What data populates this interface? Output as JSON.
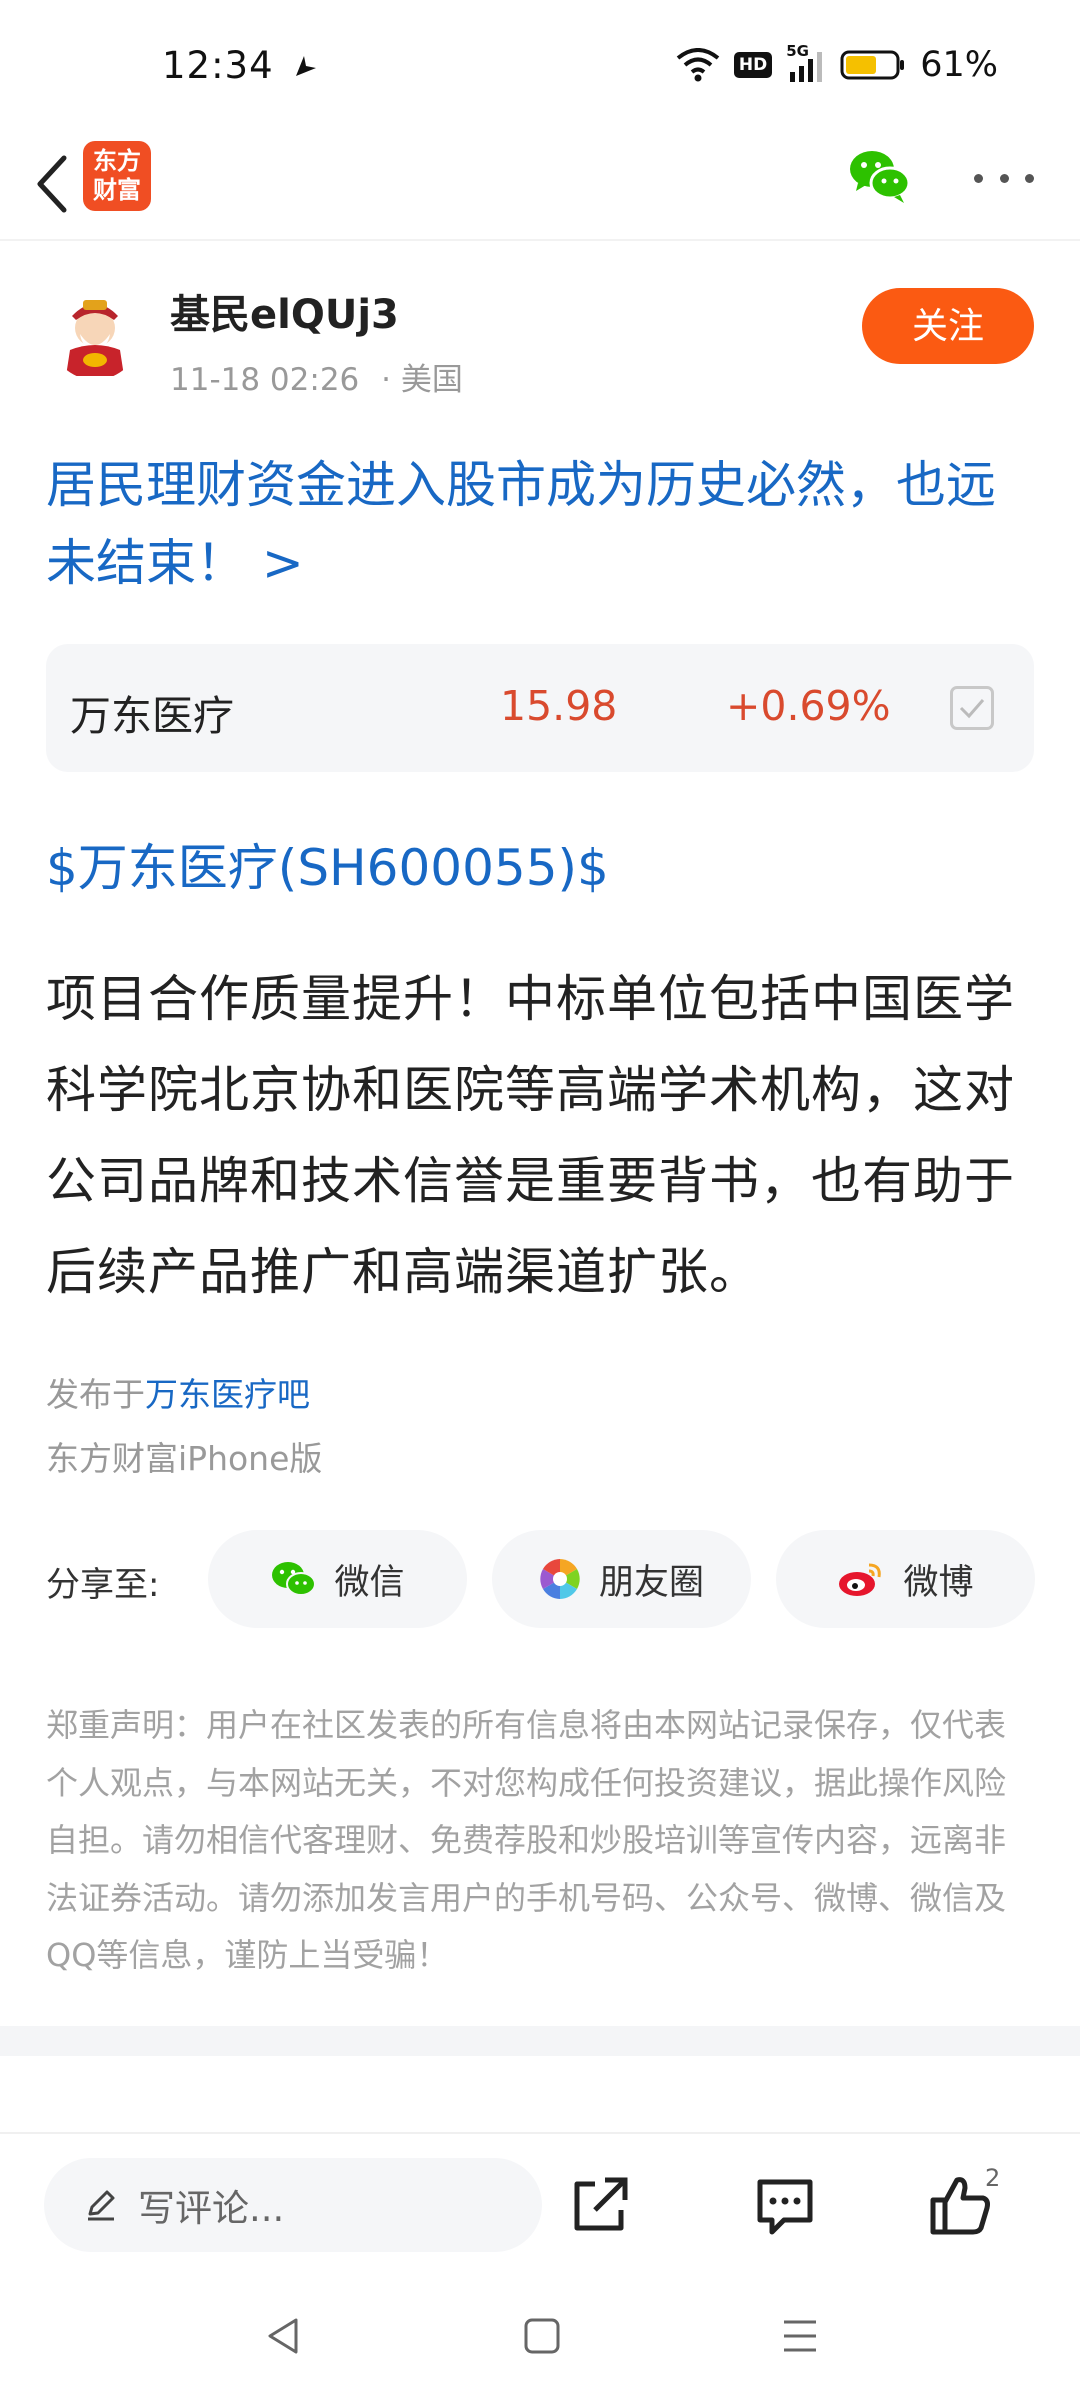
{
  "status_bar": {
    "time": "12:34",
    "network": "5G",
    "hd": "HD",
    "battery": "61%"
  },
  "header": {
    "logo_line1": "东方",
    "logo_line2": "财富",
    "icons": [
      "back-arrow-icon",
      "wechat-icon",
      "more-icon"
    ]
  },
  "author": {
    "name": "基民elQUj3",
    "time": "11-18 02:26",
    "location": "· 美国",
    "follow_label": "关注"
  },
  "post": {
    "title": "居民理财资金进入股市成为历史必然，也远未结束！ >",
    "stock_tag": "$万东医疗(SH600055)$",
    "body": "项目合作质量提升！中标单位包括中国医学科学院北京协和医院等高端学术机构，这对公司品牌和技术信誉是重要背书，也有助于后续产品推广和高端渠道扩张。",
    "publish_prefix": "发布于",
    "publish_bar": "万东医疗吧",
    "client": "东方财富iPhone版"
  },
  "stock_card": {
    "name": "万东医疗",
    "price": "15.98",
    "change": "+0.69%",
    "price_color": "#d94a2e"
  },
  "share": {
    "label": "分享至:",
    "wechat": "微信",
    "moments": "朋友圈",
    "weibo": "微博"
  },
  "disclaimer": "郑重声明：用户在社区发表的所有信息将由本网站记录保存，仅代表个人观点，与本网站无关，不对您构成任何投资建议，据此操作风险自担。请勿相信代客理财、免费荐股和炒股培训等宣传内容，远离非法证券活动。请勿添加发言用户的手机号码、公众号、微博、微信及QQ等信息，谨防上当受骗！",
  "bottom_bar": {
    "comment_placeholder": "写评论...",
    "like_count": "2"
  },
  "colors": {
    "accent_blue": "#1868c4",
    "follow_orange": "#fb5a12",
    "rise_red": "#d94a2e"
  }
}
